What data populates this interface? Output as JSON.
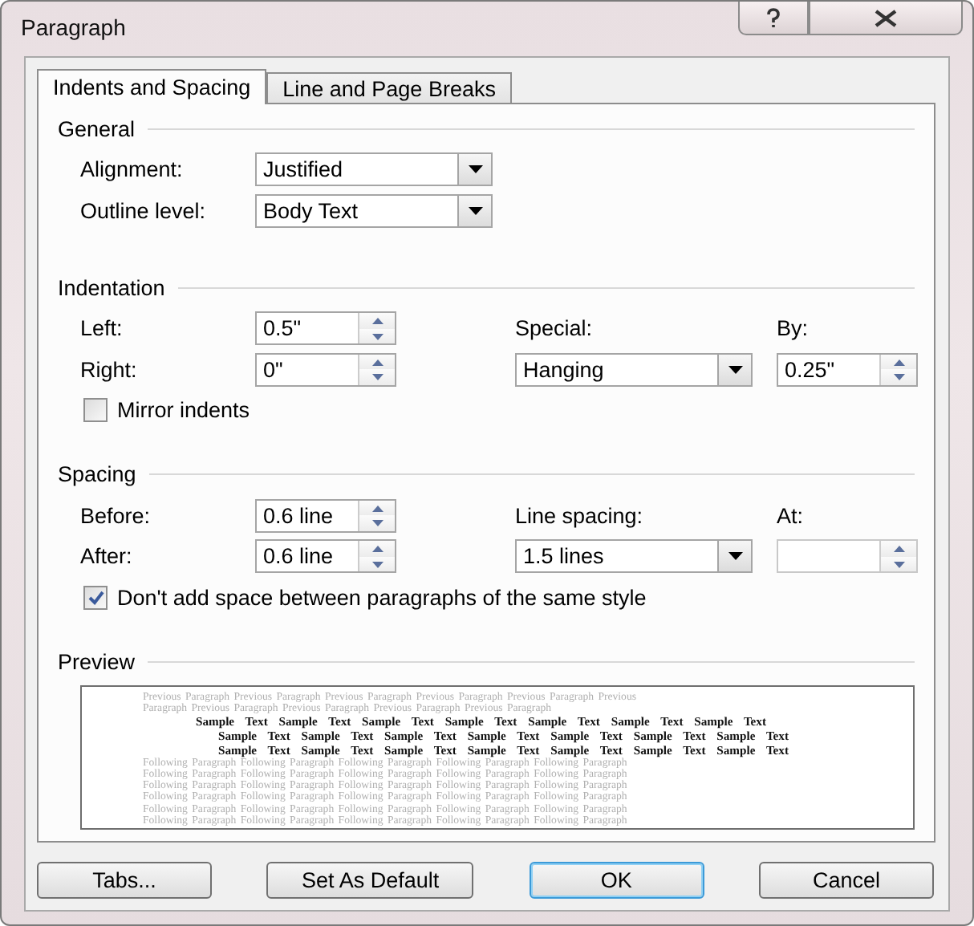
{
  "window": {
    "title": "Paragraph"
  },
  "tabs": [
    {
      "label": "Indents and Spacing",
      "selected": true
    },
    {
      "label": "Line and Page Breaks",
      "selected": false
    }
  ],
  "sections": [
    {
      "title": "General",
      "rows": [
        [
          {
            "kind": "label",
            "label": "Alignment:"
          },
          {
            "kind": "dropdown",
            "value": "Justified"
          }
        ],
        [
          {
            "kind": "label",
            "label": "Outline level:"
          },
          {
            "kind": "dropdown",
            "value": "Body Text"
          }
        ]
      ]
    },
    {
      "title": "Indentation",
      "rows": [
        [
          {
            "kind": "label",
            "label": "Left:"
          },
          {
            "kind": "spinner",
            "value": "0.5\""
          },
          {
            "kind": "label",
            "label": "Special:"
          },
          {
            "kind": "label",
            "label": "By:"
          }
        ],
        [
          {
            "kind": "label",
            "label": "Right:"
          },
          {
            "kind": "spinner",
            "value": "0\""
          },
          {
            "kind": "dropdown",
            "value": "Hanging"
          },
          {
            "kind": "spinner",
            "value": "0.25\""
          }
        ],
        [
          {
            "kind": "checkbox",
            "label": "Mirror indents",
            "checked": false
          }
        ]
      ]
    },
    {
      "title": "Spacing",
      "rows": [
        [
          {
            "kind": "label",
            "label": "Before:"
          },
          {
            "kind": "spinner",
            "value": "0.6 line"
          },
          {
            "kind": "label",
            "label": "Line spacing:"
          },
          {
            "kind": "label",
            "label": "At:"
          }
        ],
        [
          {
            "kind": "label",
            "label": "After:"
          },
          {
            "kind": "spinner",
            "value": "0.6 line"
          },
          {
            "kind": "dropdown",
            "value": "1.5 lines"
          },
          {
            "kind": "spinner",
            "disabled": true
          }
        ],
        [
          {
            "kind": "checkbox",
            "label": "Don't add space between paragraphs of the same style",
            "checked": true
          }
        ]
      ]
    }
  ],
  "preview": {
    "title": "Preview",
    "lines": [
      {
        "kind": "previous",
        "text": "Previous Paragraph Previous Paragraph Previous Paragraph Previous Paragraph Previous Paragraph Previous"
      },
      {
        "kind": "previous",
        "text": "Paragraph Previous Paragraph Previous Paragraph Previous Paragraph Previous Paragraph"
      },
      {
        "kind": "sample-first",
        "text": "Sample Text Sample Text Sample Text Sample Text Sample Text Sample Text Sample Text"
      },
      {
        "kind": "sample",
        "text": "Sample Text Sample Text Sample Text Sample Text Sample Text Sample Text Sample Text"
      },
      {
        "kind": "sample",
        "text": "Sample Text Sample Text Sample Text Sample Text Sample Text Sample Text Sample Text"
      },
      {
        "kind": "following",
        "text": "Following Paragraph Following Paragraph Following Paragraph Following Paragraph Following Paragraph"
      },
      {
        "kind": "following",
        "text": "Following Paragraph Following Paragraph Following Paragraph Following Paragraph Following Paragraph"
      },
      {
        "kind": "following",
        "text": "Following Paragraph Following Paragraph Following Paragraph Following Paragraph Following Paragraph"
      },
      {
        "kind": "following",
        "text": "Following Paragraph Following Paragraph Following Paragraph Following Paragraph Following Paragraph"
      },
      {
        "kind": "following",
        "text": "Following Paragraph Following Paragraph Following Paragraph Following Paragraph Following Paragraph"
      },
      {
        "kind": "following",
        "text": "Following Paragraph Following Paragraph Following Paragraph Following Paragraph Following Paragraph"
      }
    ]
  },
  "buttons": [
    {
      "label": "Tabs...",
      "default": false
    },
    {
      "label": "Set As Default",
      "default": false
    },
    {
      "label": "OK",
      "default": true
    },
    {
      "label": "Cancel",
      "default": false
    }
  ]
}
